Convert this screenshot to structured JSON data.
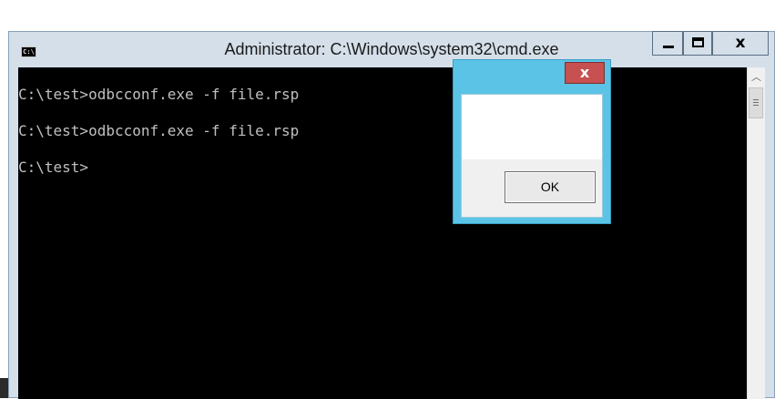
{
  "window": {
    "title": "Administrator: C:\\Windows\\system32\\cmd.exe",
    "icon": "cmd-icon",
    "icon_text": "C:\\",
    "buttons": {
      "minimize": "minimize-icon",
      "maximize": "maximize-icon",
      "close": "x"
    }
  },
  "console": {
    "lines": [
      "C:\\test>odbcconf.exe -f file.rsp",
      "C:\\test>odbcconf.exe -f file.rsp",
      "C:\\test>"
    ],
    "colors": {
      "background": "#000000",
      "text": "#c0c0c0"
    }
  },
  "dialog": {
    "close_label": "x",
    "ok_label": "OK",
    "colors": {
      "frame": "#5bc4e6",
      "close": "#c75050"
    }
  }
}
